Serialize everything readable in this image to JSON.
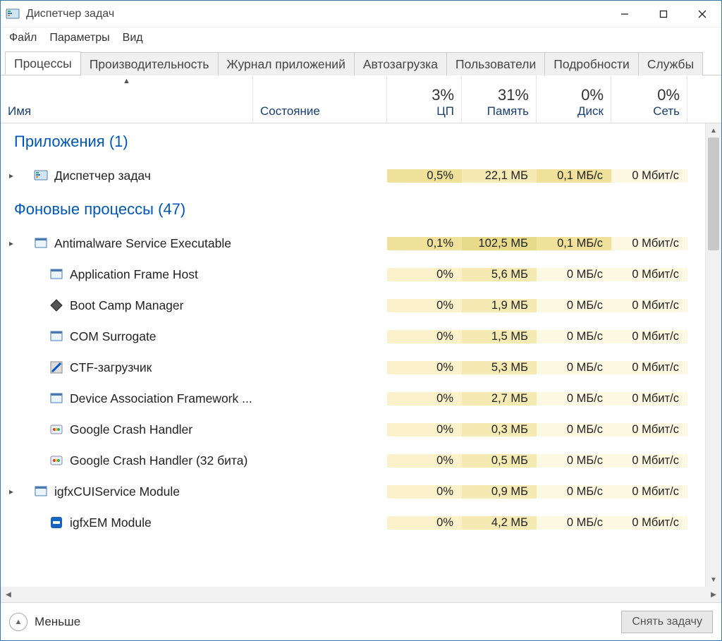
{
  "window": {
    "title": "Диспетчер задач"
  },
  "menu": {
    "file": "Файл",
    "options": "Параметры",
    "view": "Вид"
  },
  "tabs": {
    "processes": "Процессы",
    "performance": "Производительность",
    "apphistory": "Журнал приложений",
    "startup": "Автозагрузка",
    "users": "Пользователи",
    "details": "Подробности",
    "services": "Службы"
  },
  "columns": {
    "name": "Имя",
    "state": "Состояние",
    "cpu": {
      "value": "3%",
      "label": "ЦП"
    },
    "memory": {
      "value": "31%",
      "label": "Память"
    },
    "disk": {
      "value": "0%",
      "label": "Диск"
    },
    "network": {
      "value": "0%",
      "label": "Сеть"
    }
  },
  "groups": {
    "apps": "Приложения (1)",
    "bg": "Фоновые процессы (47)"
  },
  "rows": [
    {
      "expandable": true,
      "icon": "taskmgr",
      "name": "Диспетчер задач",
      "cpu": "0,5%",
      "mem": "22,1 МБ",
      "disk": "0,1 МБ/с",
      "net": "0 Мбит/с",
      "h_cpu": "hD",
      "h_mem": "hC",
      "h_disk": "hD",
      "h_net": "hA"
    },
    {
      "expandable": true,
      "icon": "app",
      "name": "Antimalware Service Executable",
      "cpu": "0,1%",
      "mem": "102,5 МБ",
      "disk": "0,1 МБ/с",
      "net": "0 Мбит/с",
      "h_cpu": "hD",
      "h_mem": "hE",
      "h_disk": "hD",
      "h_net": "hA"
    },
    {
      "expandable": false,
      "icon": "app",
      "name": "Application Frame Host",
      "cpu": "0%",
      "mem": "5,6 МБ",
      "disk": "0 МБ/с",
      "net": "0 Мбит/с",
      "h_cpu": "hB",
      "h_mem": "hC",
      "h_disk": "hA",
      "h_net": "hA"
    },
    {
      "expandable": false,
      "icon": "diamond",
      "name": "Boot Camp Manager",
      "cpu": "0%",
      "mem": "1,9 МБ",
      "disk": "0 МБ/с",
      "net": "0 Мбит/с",
      "h_cpu": "hB",
      "h_mem": "hC",
      "h_disk": "hA",
      "h_net": "hA"
    },
    {
      "expandable": false,
      "icon": "app",
      "name": "COM Surrogate",
      "cpu": "0%",
      "mem": "1,5 МБ",
      "disk": "0 МБ/с",
      "net": "0 Мбит/с",
      "h_cpu": "hB",
      "h_mem": "hC",
      "h_disk": "hA",
      "h_net": "hA"
    },
    {
      "expandable": false,
      "icon": "ctf",
      "name": "CTF-загрузчик",
      "cpu": "0%",
      "mem": "5,3 МБ",
      "disk": "0 МБ/с",
      "net": "0 Мбит/с",
      "h_cpu": "hB",
      "h_mem": "hC",
      "h_disk": "hA",
      "h_net": "hA"
    },
    {
      "expandable": false,
      "icon": "app",
      "name": "Device Association Framework ...",
      "cpu": "0%",
      "mem": "2,7 МБ",
      "disk": "0 МБ/с",
      "net": "0 Мбит/с",
      "h_cpu": "hB",
      "h_mem": "hC",
      "h_disk": "hA",
      "h_net": "hA"
    },
    {
      "expandable": false,
      "icon": "gcrash",
      "name": "Google Crash Handler",
      "cpu": "0%",
      "mem": "0,3 МБ",
      "disk": "0 МБ/с",
      "net": "0 Мбит/с",
      "h_cpu": "hB",
      "h_mem": "hC",
      "h_disk": "hA",
      "h_net": "hA"
    },
    {
      "expandable": false,
      "icon": "gcrash",
      "name": "Google Crash Handler (32 бита)",
      "cpu": "0%",
      "mem": "0,5 МБ",
      "disk": "0 МБ/с",
      "net": "0 Мбит/с",
      "h_cpu": "hB",
      "h_mem": "hC",
      "h_disk": "hA",
      "h_net": "hA"
    },
    {
      "expandable": true,
      "icon": "app",
      "name": "igfxCUIService Module",
      "cpu": "0%",
      "mem": "0,9 МБ",
      "disk": "0 МБ/с",
      "net": "0 Мбит/с",
      "h_cpu": "hB",
      "h_mem": "hC",
      "h_disk": "hA",
      "h_net": "hA"
    },
    {
      "expandable": false,
      "icon": "intel",
      "name": "igfxEM Module",
      "cpu": "0%",
      "mem": "4,2 МБ",
      "disk": "0 МБ/с",
      "net": "0 Мбит/с",
      "h_cpu": "hB",
      "h_mem": "hC",
      "h_disk": "hA",
      "h_net": "hA"
    }
  ],
  "footer": {
    "collapse": "Меньше",
    "endtask": "Снять задачу"
  }
}
